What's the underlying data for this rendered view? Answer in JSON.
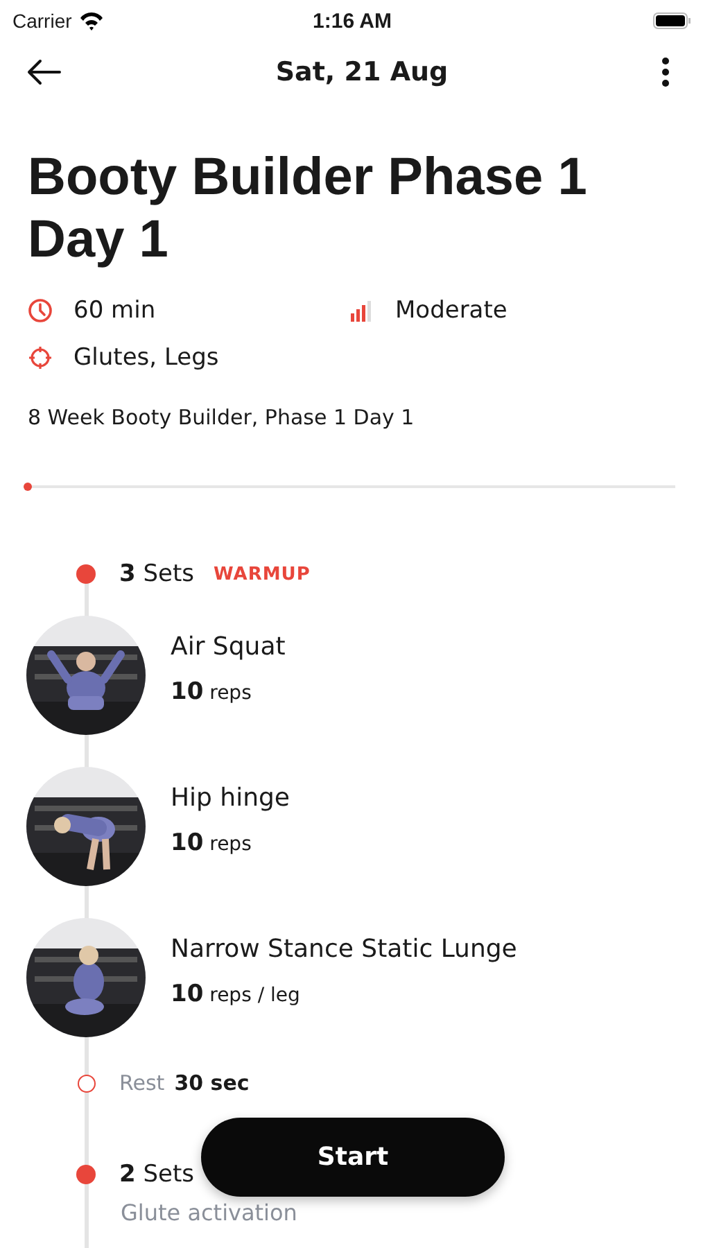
{
  "status_bar": {
    "carrier": "Carrier",
    "time": "1:16 AM"
  },
  "header": {
    "title": "Sat, 21 Aug"
  },
  "workout": {
    "title": "Booty Builder Phase 1 Day 1",
    "meta": [
      {
        "kind": "duration",
        "text": "60 min"
      },
      {
        "kind": "intensity",
        "text": "Moderate"
      },
      {
        "kind": "target",
        "text": "Glutes, Legs"
      }
    ],
    "description": "8 Week Booty Builder, Phase 1 Day 1",
    "progress": {
      "level": 0
    }
  },
  "groups": [
    {
      "sets_count": "3",
      "sets_label": "Sets",
      "tag": "WARMUP",
      "items": [
        {
          "kind": "exercise",
          "name": "Air Squat",
          "count": "10",
          "unit": "reps"
        },
        {
          "kind": "exercise",
          "name": "Hip hinge",
          "count": "10",
          "unit": "reps"
        },
        {
          "kind": "exercise",
          "name": "Narrow Stance Static Lunge",
          "count": "10",
          "unit": "reps / leg"
        },
        {
          "kind": "rest",
          "label": "Rest",
          "value": "30 sec"
        }
      ]
    },
    {
      "sets_count": "2",
      "sets_label": "Sets",
      "subtitle": "Glute activation"
    }
  ],
  "start_button": "Start"
}
